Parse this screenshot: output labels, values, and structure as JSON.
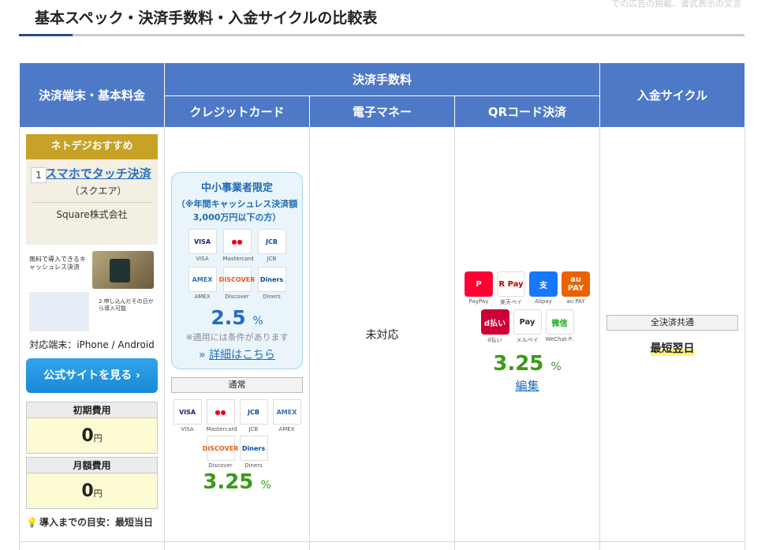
{
  "page": {
    "faint_text": "での広告の掲載、書式表示の文言",
    "section_title": "基本スペック・決済手数料・入金サイクルの比較表"
  },
  "table": {
    "headers": {
      "terminal": "決済端末・基本料金",
      "fees": "決済手数料",
      "credit": "クレジットカード",
      "emoney": "電子マネー",
      "qr": "QRコード決済",
      "cycle": "入金サイクル"
    }
  },
  "product": {
    "badge": "ネトデジおすすめ",
    "rank": "1",
    "name": "スマホでタッチ決済",
    "sub": "（スクエア）",
    "company": "Square株式会社",
    "thumb_text_a": "無料で導入できるキャッシュレス決済",
    "thumb_text_b": "2.申し込んだその日から導入可能",
    "device": "対応端末：iPhone / Android",
    "cta": "公式サイトを見る ›",
    "initial_label": "初期費用",
    "initial_value": "0",
    "monthly_label": "月額費用",
    "monthly_value": "0",
    "yen": "円",
    "lead_time": "導入までの目安：最短当日"
  },
  "credit": {
    "promo_title": "中小事業者限定",
    "promo_sub": "（※年間キャッシュレス決済額3,000万円以下の方）",
    "promo_brands": [
      {
        "name": "VISA",
        "color": "#1a1f71",
        "text": "VISA"
      },
      {
        "name": "Mastercard",
        "color": "#eb001b",
        "text": "●●"
      },
      {
        "name": "JCB",
        "color": "#0e4c96",
        "text": "JCB"
      },
      {
        "name": "AMEX",
        "color": "#2e77bb",
        "text": "AMEX"
      },
      {
        "name": "Discover",
        "color": "#e55c20",
        "text": "DISCOVER"
      },
      {
        "name": "Diners",
        "color": "#004a97",
        "text": "Diners"
      }
    ],
    "promo_rate": "2.5",
    "percent": "%",
    "note": "※適用には条件があります",
    "detail_link": "詳細はこちら",
    "normal_label": "通常",
    "normal_rate": "3.25"
  },
  "emoney": {
    "status": "未対応"
  },
  "qr": {
    "brands": [
      {
        "name": "PayPay",
        "color": "#ff0033",
        "text": "P"
      },
      {
        "name": "楽天ペイ",
        "color": "#ffffff",
        "text": "R Pay",
        "fg": "#bf0000"
      },
      {
        "name": "Alipay",
        "color": "#1677ff",
        "text": "支"
      },
      {
        "name": "au PAY",
        "color": "#eb6100",
        "text": "au PAY"
      },
      {
        "name": "d払い",
        "color": "#cc0033",
        "text": "d払い"
      },
      {
        "name": "メルペイ",
        "color": "#ffffff",
        "text": "Pay",
        "fg": "#333333"
      },
      {
        "name": "WeChat P…",
        "color": "#ffffff",
        "text": "微信",
        "fg": "#1aad19"
      }
    ],
    "rate": "3.25",
    "edit": "編集"
  },
  "cycle": {
    "tag": "全決済共通",
    "value": "最短翌日"
  },
  "colors": {
    "header_blue": "#4d79c7",
    "rate_blue": "#1f6fc0",
    "rate_green": "#3a9a18",
    "badge_gold": "#c7a227"
  }
}
